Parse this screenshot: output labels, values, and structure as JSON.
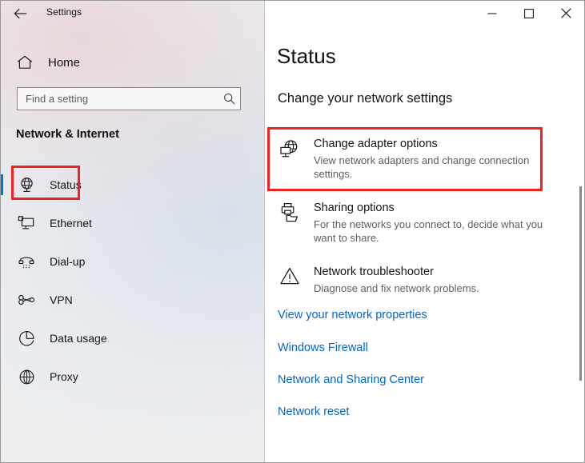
{
  "window": {
    "app_title": "Settings",
    "back_icon": "back-arrow-icon",
    "controls": {
      "minimize": "minimize-icon",
      "maximize": "maximize-icon",
      "close": "close-icon"
    }
  },
  "sidebar": {
    "home_label": "Home",
    "home_icon": "home-icon",
    "search": {
      "placeholder": "Find a setting",
      "value": "",
      "icon": "search-icon"
    },
    "section_title": "Network & Internet",
    "items": [
      {
        "label": "Status",
        "icon": "globe-status-icon",
        "selected": true
      },
      {
        "label": "Ethernet",
        "icon": "ethernet-icon",
        "selected": false
      },
      {
        "label": "Dial-up",
        "icon": "dialup-phone-icon",
        "selected": false
      },
      {
        "label": "VPN",
        "icon": "vpn-key-icon",
        "selected": false
      },
      {
        "label": "Data usage",
        "icon": "pie-chart-icon",
        "selected": false
      },
      {
        "label": "Proxy",
        "icon": "globe-proxy-icon",
        "selected": false
      }
    ]
  },
  "content": {
    "page_title": "Status",
    "subtitle": "Change your network settings",
    "features": [
      {
        "title": "Change adapter options",
        "desc": "View network adapters and change connection settings.",
        "icon": "network-adapter-icon"
      },
      {
        "title": "Sharing options",
        "desc": "For the networks you connect to, decide what you want to share.",
        "icon": "sharing-printer-icon"
      },
      {
        "title": "Network troubleshooter",
        "desc": "Diagnose and fix network problems.",
        "icon": "warning-triangle-icon"
      }
    ],
    "links": [
      "View your network properties",
      "Windows Firewall",
      "Network and Sharing Center",
      "Network reset"
    ]
  },
  "annotations": {
    "highlight_color": "#f52121",
    "boxes": [
      {
        "target": "sidebar-item-status"
      },
      {
        "target": "feature-change-adapter-options"
      }
    ]
  },
  "colors": {
    "accent": "#0078d7",
    "link": "#0266c8",
    "highlight": "#f52121",
    "text": "#141414",
    "muted_text": "#5e5e5e"
  }
}
